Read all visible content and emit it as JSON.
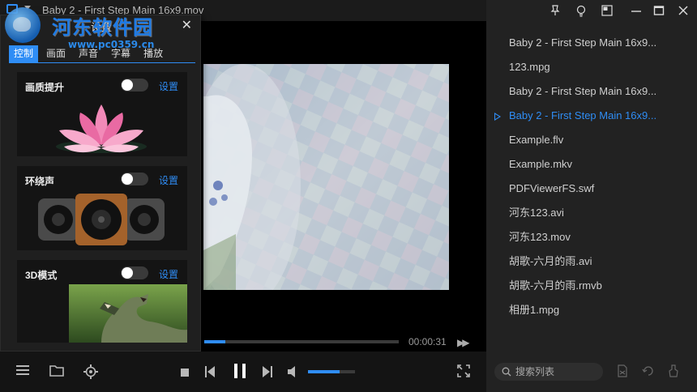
{
  "window": {
    "title": "Baby 2 - First Step Main 16x9.mov"
  },
  "watermark": {
    "text": "河东软件园",
    "url": "www.pc0359.cn"
  },
  "settings": {
    "title": "设置",
    "tabs": [
      "控制",
      "画面",
      "声音",
      "字幕",
      "播放"
    ],
    "active_tab": "控制",
    "features": [
      {
        "label": "画质提升",
        "link": "设置",
        "enabled": false
      },
      {
        "label": "环绕声",
        "link": "设置",
        "enabled": false
      },
      {
        "label": "3D模式",
        "link": "设置",
        "enabled": false
      }
    ]
  },
  "player": {
    "time": "00:00:31",
    "progress_fraction": 0.11,
    "volume_fraction": 0.68
  },
  "playlist": {
    "items": [
      "Baby 2 - First Step Main 16x9...",
      "123.mpg",
      "Baby 2 - First Step Main 16x9...",
      "Baby 2 - First Step Main 16x9...",
      "Example.flv",
      "Example.mkv",
      "PDFViewerFS.swf",
      "河东123.avi",
      "河东123.mov",
      "胡歌-六月的雨.avi",
      "胡歌-六月的雨.rmvb",
      "相册1.mpg"
    ],
    "active_index": 3,
    "search_placeholder": "搜索列表"
  },
  "colors": {
    "accent": "#2f8df5",
    "panel": "#1f1f1f",
    "sidebar": "#222222"
  },
  "icons": {
    "sidebar": [
      "pin-icon",
      "bulb-icon",
      "pip-icon",
      "minimize-icon",
      "maximize-icon",
      "close-icon"
    ],
    "controls": [
      "menu-icon",
      "folder-icon",
      "gear-icon",
      "stop-icon",
      "prev-icon",
      "pause-icon",
      "next-icon",
      "volume-icon",
      "fullscreen-icon"
    ]
  }
}
